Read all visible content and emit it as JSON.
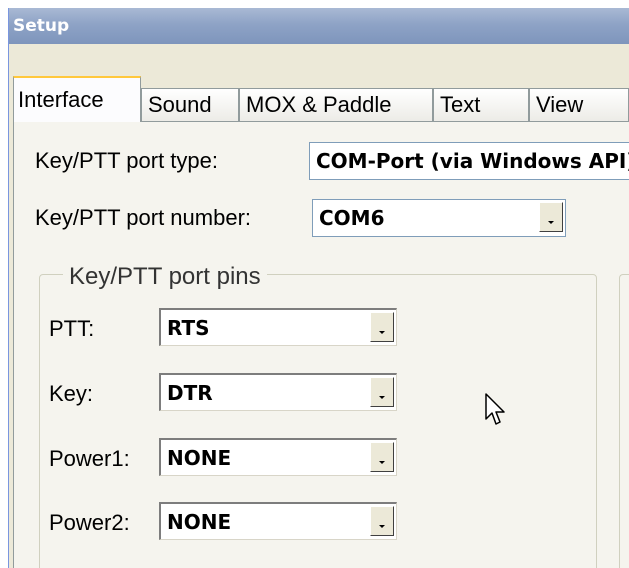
{
  "window": {
    "title": "Setup"
  },
  "tabs": [
    {
      "label": "Interface",
      "active": true
    },
    {
      "label": "Sound"
    },
    {
      "label": "MOX & Paddle"
    },
    {
      "label": "Text"
    },
    {
      "label": "View"
    }
  ],
  "interface": {
    "port_type_label": "Key/PTT port type:",
    "port_type_value": "COM-Port (via Windows API)",
    "port_number_label": "Key/PTT port number:",
    "port_number_value": "COM6",
    "pins_group_title": "Key/PTT port pins",
    "pins": [
      {
        "label": "PTT:",
        "value": "RTS"
      },
      {
        "label": "Key:",
        "value": "DTR"
      },
      {
        "label": "Power1:",
        "value": "NONE"
      },
      {
        "label": "Power2:",
        "value": "NONE"
      }
    ]
  },
  "colors": {
    "titlebar": "#8EA3C6",
    "active_tab_highlight": "#FFC83C",
    "panel": "#F5F4EE"
  },
  "icons": {
    "cursor": "mouse-pointer-icon",
    "dropdown": "chevron-down-icon"
  }
}
